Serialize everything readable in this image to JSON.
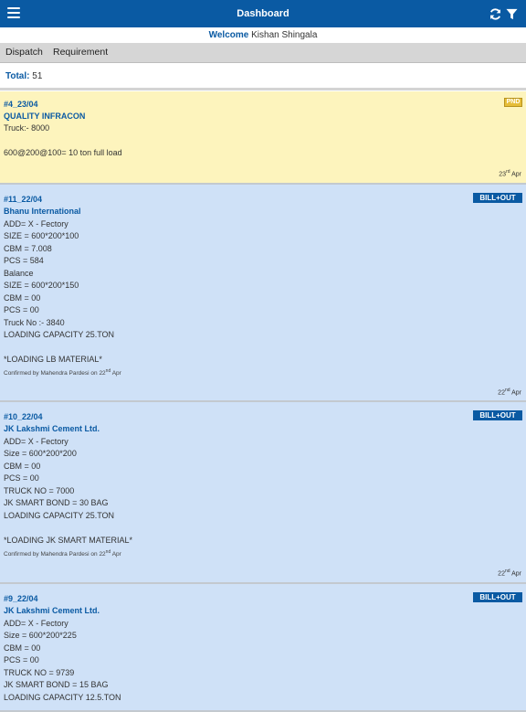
{
  "header": {
    "title": "Dashboard",
    "menu_icon": "hamburger-menu-icon",
    "refresh_icon": "refresh-icon",
    "filter_icon": "filter-funnel-icon",
    "bar_color": "#0a5aa3"
  },
  "welcome": {
    "label": "Welcome",
    "name": "Kishan Shingala"
  },
  "tabs": [
    "Dispatch",
    "Requirement"
  ],
  "total": {
    "label": "Total:",
    "value": "51"
  },
  "cards": [
    {
      "id": "#4_23/04",
      "company": "QUALITY INFRACON",
      "badge": "PND",
      "lines": [
        "Truck:- 8000",
        "",
        "600@200@100= 10 ton full load"
      ],
      "confirmed": {
        "text": "",
        "day": "",
        "suffix": "",
        "month": ""
      },
      "date": {
        "day": "23",
        "suffix": "rd",
        "month": "Apr"
      }
    },
    {
      "id": "#11_22/04",
      "company": "Bhanu International",
      "badge": "BILL+OUT",
      "lines": [
        "ADD= X - Fectory",
        "SIZE = 600*200*100",
        "CBM = 7.008",
        "PCS = 584",
        "Balance",
        "SIZE = 600*200*150",
        "CBM = 00",
        "PCS = 00",
        "Truck No :- 3840",
        "LOADING CAPACITY 25.TON",
        "",
        "*LOADING LB MATERIAL*"
      ],
      "confirmed": {
        "text": "Confirmed by Mahendra Pardesi on",
        "day": "22",
        "suffix": "nd",
        "month": "Apr"
      },
      "date": {
        "day": "22",
        "suffix": "nd",
        "month": "Apr"
      }
    },
    {
      "id": "#10_22/04",
      "company": "JK Lakshmi Cement Ltd.",
      "badge": "BILL+OUT",
      "lines": [
        "ADD= X - Fectory",
        "Size = 600*200*200",
        "CBM = 00",
        "PCS = 00",
        "TRUCK NO = 7000",
        "JK SMART BOND = 30 BAG",
        "LOADING CAPACITY 25.TON",
        "",
        "*LOADING JK SMART MATERIAL*"
      ],
      "confirmed": {
        "text": "Confirmed by Mahendra Pardesi on",
        "day": "22",
        "suffix": "nd",
        "month": "Apr"
      },
      "date": {
        "day": "22",
        "suffix": "nd",
        "month": "Apr"
      }
    },
    {
      "id": "#9_22/04",
      "company": "JK Lakshmi Cement Ltd.",
      "badge": "BILL+OUT",
      "lines": [
        "ADD= X - Fectory",
        "Size = 600*200*225",
        "CBM = 00",
        "PCS = 00",
        "TRUCK NO = 9739",
        "JK SMART BOND = 15 BAG",
        "LOADING CAPACITY 12.5.TON"
      ],
      "confirmed": {
        "text": "",
        "day": "",
        "suffix": "",
        "month": ""
      },
      "date": {
        "day": "",
        "suffix": "",
        "month": ""
      }
    }
  ],
  "colors": {
    "pending_card": "#fdf4bd",
    "billed_card": "#cfe1f7",
    "badge_pnd": "#e6bd39",
    "badge_bill": "#0a5aa3"
  }
}
